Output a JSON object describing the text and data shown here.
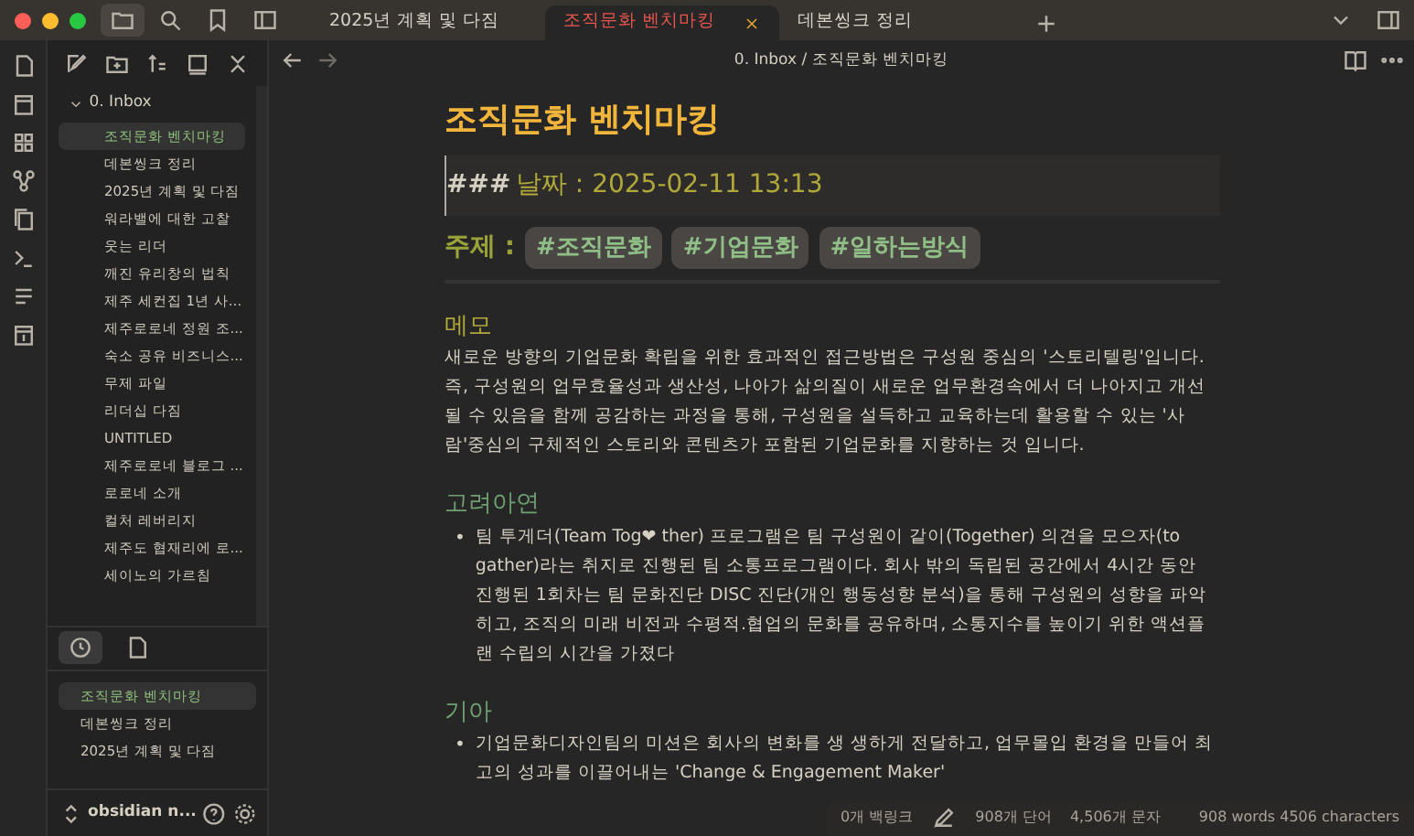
{
  "tabs": [
    {
      "label": "2025년 계획 및 다짐",
      "selected": false
    },
    {
      "label": "조직문화 벤치마킹",
      "selected": true
    },
    {
      "label": "데본씽크 정리",
      "selected": false
    }
  ],
  "breadcrumb": {
    "folder": "0. Inbox",
    "separator": "/",
    "note": "조직문화 벤치마킹"
  },
  "sidebar": {
    "folder": {
      "label": "0. Inbox",
      "expanded": true
    },
    "items": [
      {
        "label": "조직문화 벤치마킹",
        "selected": true
      },
      {
        "label": "데본씽크 정리",
        "selected": false
      },
      {
        "label": "2025년 계획 및 다짐",
        "selected": false
      },
      {
        "label": "워라밸에 대한 고찰",
        "selected": false
      },
      {
        "label": "웃는 리더",
        "selected": false
      },
      {
        "label": "깨진 유리창의 법칙",
        "selected": false
      },
      {
        "label": "제주 세컨집 1년 사...",
        "selected": false
      },
      {
        "label": "제주로로네 정원 조...",
        "selected": false
      },
      {
        "label": "숙소 공유 비즈니스...",
        "selected": false
      },
      {
        "label": "무제 파일",
        "selected": false
      },
      {
        "label": "리더십 다짐",
        "selected": false
      },
      {
        "label": "UNTITLED",
        "selected": false
      },
      {
        "label": "제주로로네 블로그 ...",
        "selected": false
      },
      {
        "label": "로로네 소개",
        "selected": false
      },
      {
        "label": "컬처 레버리지",
        "selected": false
      },
      {
        "label": "제주도 협재리에 로...",
        "selected": false
      },
      {
        "label": "세이노의 가르침",
        "selected": false
      }
    ],
    "recent": [
      {
        "label": "조직문화 벤치마킹",
        "selected": true
      },
      {
        "label": "데본씽크 정리",
        "selected": false
      },
      {
        "label": "2025년 계획 및 다짐",
        "selected": false
      }
    ],
    "vault": "obsidian n..."
  },
  "note": {
    "title": "조직문화 벤치마킹",
    "date_line": {
      "marker": "###",
      "label": "날짜 : 2025-02-11 13:13"
    },
    "topic": {
      "label": "주제 :",
      "tags": [
        "#조직문화",
        "#기업문화",
        "#일하는방식"
      ]
    },
    "sections": [
      {
        "heading": "메모",
        "kind": "paragraph",
        "text": "새로운 방향의 기업문화 확립을 위한 효과적인 접근방법은 구성원 중심의 '스토리텔링'입니다. 즉, 구성원의 업무효율성과 생산성, 나아가 삶의질이 새로운 업무환경속에서 더 나아지고 개선될 수 있음을 함께 공감하는 과정을 통해, 구성원을 설득하고 교육하는데 활용할 수 있는 '사람'중심의 구체적인 스토리와 콘텐츠가 포함된 기업문화를 지향하는 것 입니다."
      },
      {
        "heading": "고려아연",
        "kind": "bullet",
        "bullet": "•",
        "text": "팀 투게더(Team Tog❤ ther) 프로그램은 팀 구성원이 같이(Together) 의견을 모으자(to gather)라는 취지로 진행된 팀 소통프로그램이다. 회사 밖의 독립된 공간에서 4시간 동안 진행된 1회차는 팀 문화진단 DISC 진단(개인 행동성향 분석)을 통해 구성원의 성향을 파악히고, 조직의 미래 비전과 수평적.협업의 문화를 공유하며, 소통지수를 높이기 위한 액션플랜 수립의 시간을 가졌다"
      },
      {
        "heading": "기아",
        "kind": "bullet",
        "bullet": "•",
        "text": "기업문화디자인팀의 미션은 회사의 변화를 생 생하게 전달하고, 업무몰입 환경을 만들어 최고의 성과를 이끌어내는 'Change & Engagement Maker'"
      }
    ]
  },
  "status_bar": {
    "backlinks": "0개 백링크",
    "words": "908개 단어",
    "chars": "4,506개 문자",
    "summary": "908 words 4506 characters"
  }
}
